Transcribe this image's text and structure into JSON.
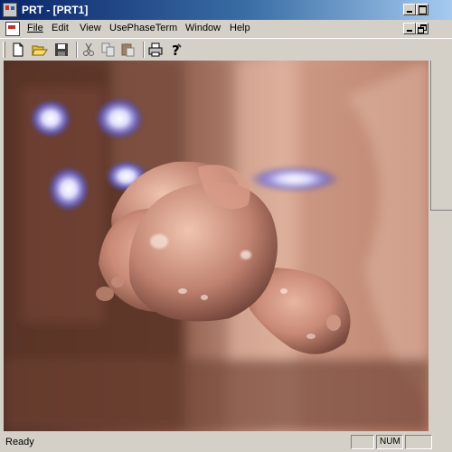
{
  "window": {
    "title": "PRT - [PRT1]"
  },
  "menu": {
    "items": [
      {
        "label": "File",
        "name": "menu-file"
      },
      {
        "label": "Edit",
        "name": "menu-edit"
      },
      {
        "label": "View",
        "name": "menu-view"
      },
      {
        "label": "UsePhaseTerm",
        "name": "menu-usephaseterm"
      },
      {
        "label": "Window",
        "name": "menu-window"
      },
      {
        "label": "Help",
        "name": "menu-help"
      }
    ]
  },
  "toolbar": {
    "icons": [
      "new-file-icon",
      "open-folder-icon",
      "save-icon",
      "cut-icon",
      "copy-icon",
      "paste-icon",
      "print-icon",
      "help-icon"
    ]
  },
  "status": {
    "text": "Ready",
    "num_indicator": "NUM"
  },
  "colors": {
    "title_active": "#0a246a",
    "title_gradient_end": "#a6caf0",
    "chrome": "#d4d0c8"
  }
}
